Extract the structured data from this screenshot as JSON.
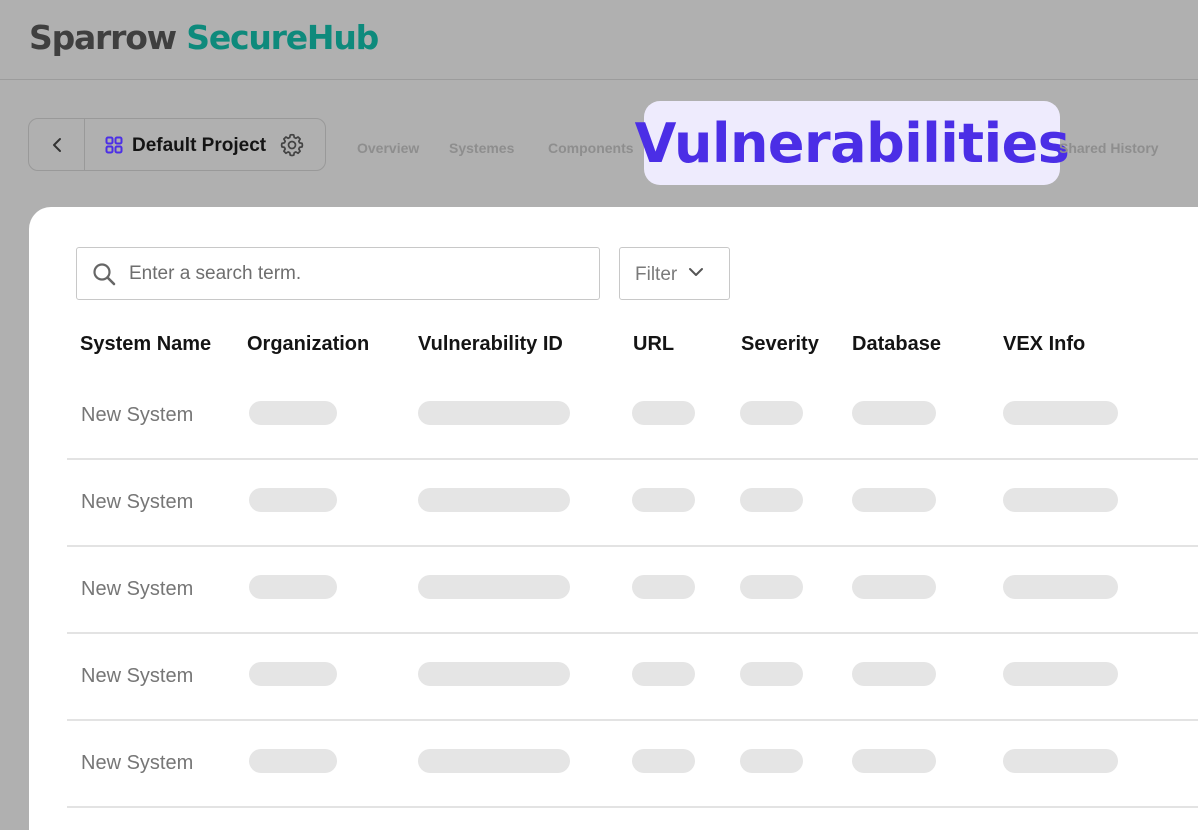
{
  "header": {
    "logo_part1": "Sparrow",
    "logo_part2": "SecureHub"
  },
  "project": {
    "name": "Default Project"
  },
  "tabs": [
    {
      "label": "Overview"
    },
    {
      "label": "Systemes"
    },
    {
      "label": "Components"
    },
    {
      "label": "Vulnerabilities",
      "active": true
    },
    {
      "label": "Shared History"
    }
  ],
  "search": {
    "placeholder": "Enter a search term."
  },
  "filter": {
    "label": "Filter"
  },
  "table": {
    "columns": [
      "System Name",
      "Organization",
      "Vulnerability ID",
      "URL",
      "Severity",
      "Database",
      "VEX Info"
    ],
    "rows": [
      {
        "system_name": "New System"
      },
      {
        "system_name": "New System"
      },
      {
        "system_name": "New System"
      },
      {
        "system_name": "New System"
      },
      {
        "system_name": "New System"
      }
    ]
  },
  "colors": {
    "brand_dark": "#3f3f3f",
    "brand_teal": "#0e8a7c",
    "accent": "#4b2ee6",
    "accent_bg": "#eeebfd",
    "skeleton": "#e5e5e5"
  }
}
